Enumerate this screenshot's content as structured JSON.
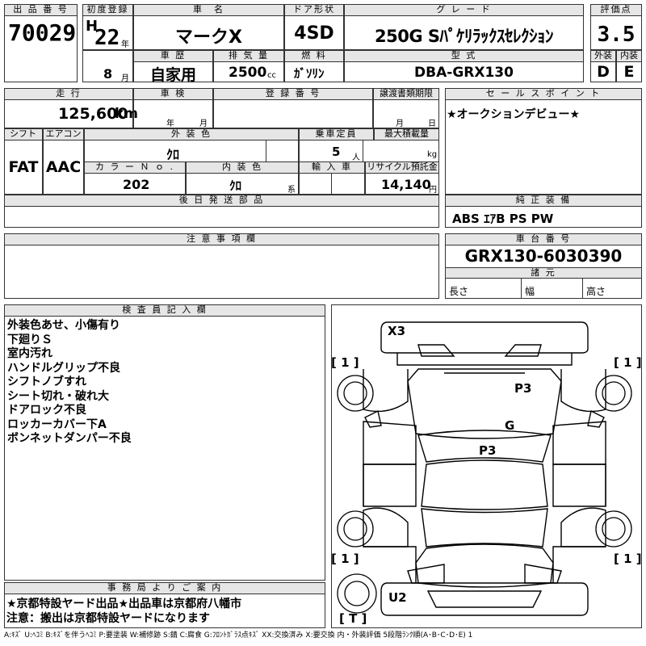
{
  "headers": {
    "lot_no": "出 品 番 号",
    "first_reg": "初度登録",
    "car_name": "車　名",
    "door": "ドア形状",
    "grade": "グ レ ー ド",
    "score": "評価点",
    "history": "車 歴",
    "displacement": "排 気 量",
    "fuel": "燃 料",
    "model_code": "型 式",
    "exterior": "外装",
    "interior": "内装",
    "mileage": "走 行",
    "inspection": "車 検",
    "reg_no": "登 録 番 号",
    "transfer": "譲渡書類期限",
    "sales_point": "セ ー ル ス ポ イ ン ト",
    "shift": "シフト",
    "aircon": "エアコン",
    "ext_color": "外 装 色",
    "capacity": "乗車定員",
    "max_load": "最大積載量",
    "color_no": "カ ラ ー Ｎ ｏ .",
    "int_color": "内 装 色",
    "import": "輸 入 車",
    "recycle": "リサイクル預託金",
    "later_parts": "後 日 発 送 部 品",
    "genuine": "純 正 装 備",
    "caution": "注 意 事 項 欄",
    "chassis_no": "車 台 番 号",
    "spec": "諸 元",
    "inspector": "検 査 員 記 入 欄",
    "office": "事 務 局 よ り ご 案 内"
  },
  "lot": {
    "number": "70029"
  },
  "first_reg": {
    "era": "H",
    "year": "22",
    "year_unit": "年",
    "month": "8",
    "month_unit": "月"
  },
  "car": {
    "name": "マークX",
    "door": "4SD",
    "grade": "250G Sﾊﾟｹﾘﾗｯｸｽｾﾚｸｼｮﾝ",
    "history": "自家用",
    "displacement": "2500",
    "displacement_unit": "cc",
    "fuel": "ｶﾞｿﾘﾝ",
    "model_code": "DBA-GRX130"
  },
  "score": {
    "overall": "3.5",
    "exterior": "D",
    "interior": "E"
  },
  "mileage": {
    "value": "125,600",
    "unit": "km"
  },
  "inspection": {
    "year_unit": "年",
    "month_unit": "月"
  },
  "transfer": {
    "month_unit": "月",
    "day_unit": "日"
  },
  "sales_point": {
    "text": "★オークションデビュー★"
  },
  "spec_row": {
    "shift": "FAT",
    "aircon": "AAC",
    "ext_color": "ｸﾛ",
    "capacity": "5",
    "capacity_unit": "人",
    "max_load_unit": "kg",
    "color_no": "202",
    "int_color": "ｸﾛ",
    "int_color_unit": "系",
    "recycle": "14,140",
    "recycle_unit": "円"
  },
  "genuine": {
    "text": "ABS ｴｱB PS PW"
  },
  "chassis": {
    "number": "GRX130-6030390"
  },
  "dims": {
    "length": "長さ",
    "width": "幅",
    "height": "高さ"
  },
  "inspector_notes": [
    "外装色あせ、小傷有り",
    "下廻りＳ",
    "室内汚れ",
    "ハンドルグリップ不良",
    "シフトノブすれ",
    "シート切れ・破れ大",
    "ドアロック不良",
    "ロッカーカバー下A",
    "ボンネットダンパー不良"
  ],
  "office_notes": [
    "★京都特設ヤード出品★出品車は京都府八幡市",
    "注意：搬出は京都特設ヤードになります"
  ],
  "diagram": {
    "marks": {
      "x3": "X3",
      "p3_upper": "P3",
      "g": "G",
      "p3_lower": "P3",
      "u2": "U2"
    },
    "tires": {
      "fl": "[ 1 ]",
      "fr": "[ 1 ]",
      "rl": "[ 1 ]",
      "rr": "[ 1 ]",
      "spare": "[ T ]"
    }
  },
  "legend": "A:ｷｽﾞ U:ﾍｺﾐ B:ｷｽﾞを伴うﾍｺﾐ P:要塗装 W:補修跡 S:錆 C:腐食 G:ﾌﾛﾝﾄｶﾞﾗｽ点ｷｽﾞ XX:交換済み X:要交換 内・外装評価 5段階ﾗﾝｸ順(A･B･C･D･E) 1"
}
